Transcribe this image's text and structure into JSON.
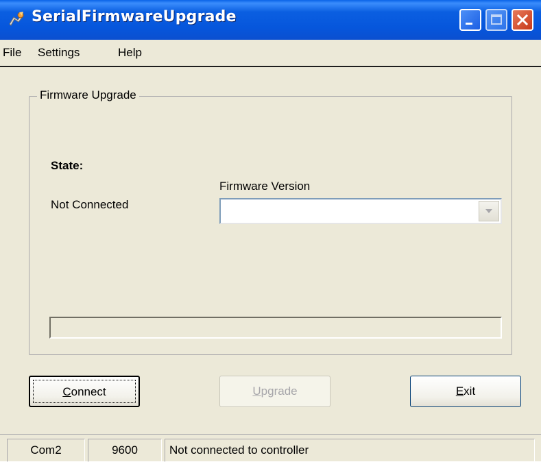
{
  "window": {
    "title": "SerialFirmwareUpgrade",
    "icon": "app-icon",
    "controls": [
      "minimize",
      "maximize",
      "close"
    ]
  },
  "menu": {
    "items": [
      {
        "label": "File"
      },
      {
        "label": "Settings"
      },
      {
        "label": "Help"
      }
    ]
  },
  "group": {
    "title": "Firmware Upgrade",
    "state_label": "State:",
    "state_value": "Not Connected",
    "firmware_label": "Firmware Version",
    "firmware_value": "",
    "progress_percent": 0
  },
  "buttons": {
    "connect": {
      "label_mnemonic": "C",
      "label_rest": "onnect",
      "enabled": true,
      "focused": true
    },
    "upgrade": {
      "label_mnemonic": "U",
      "label_rest": "pgrade",
      "enabled": false
    },
    "exit": {
      "label_mnemonic": "E",
      "label_rest": "xit",
      "enabled": true
    }
  },
  "status": {
    "port": "Com2",
    "baud": "9600",
    "message": "Not connected to controller"
  },
  "colors": {
    "titlebar": "#0656dc",
    "window_bg": "#ece9d8",
    "close_button": "#c7391a"
  }
}
